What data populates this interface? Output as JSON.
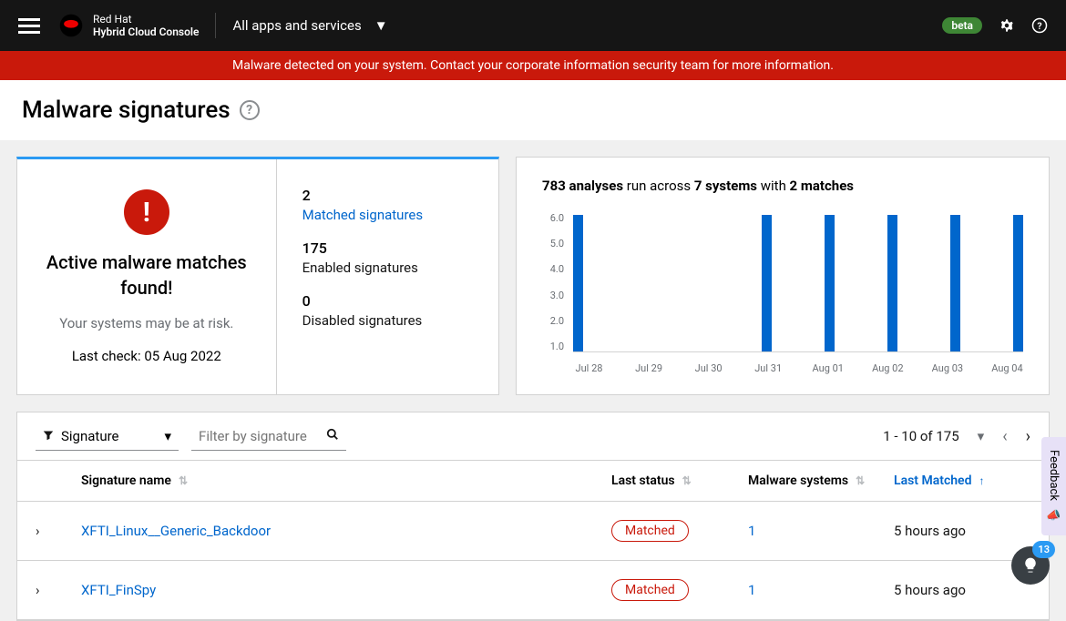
{
  "header": {
    "brand_top": "Red Hat",
    "brand_bottom": "Hybrid Cloud Console",
    "apps_label": "All apps and services",
    "beta": "beta"
  },
  "alert": "Malware detected on your system. Contact your corporate information security team for more information.",
  "page": {
    "title": "Malware signatures"
  },
  "summary": {
    "title_line1": "Active malware matches",
    "title_line2": "found!",
    "subtitle": "Your systems may be at risk.",
    "last_check_label": "Last check: ",
    "last_check_date": "05 Aug 2022"
  },
  "stats": {
    "matched_count": "2",
    "matched_label": "Matched signatures",
    "enabled_count": "175",
    "enabled_label": "Enabled signatures",
    "disabled_count": "0",
    "disabled_label": "Disabled signatures"
  },
  "analyses": {
    "count": "783",
    "text1": " analyses ",
    "text2": "run across ",
    "systems": "7 systems",
    "text3": " with ",
    "matches": "2 matches"
  },
  "chart_data": {
    "type": "bar",
    "categories": [
      "Jul 28",
      "Jul 29",
      "Jul 30",
      "Jul 31",
      "Aug 01",
      "Aug 02",
      "Aug 03",
      "Aug 04"
    ],
    "values": [
      6.0,
      0,
      0,
      6.0,
      6.0,
      6.0,
      6.0,
      6.0
    ],
    "ylim": [
      0,
      6.0
    ],
    "yticks": [
      "6.0",
      "5.0",
      "4.0",
      "3.0",
      "2.0",
      "1.0"
    ]
  },
  "toolbar": {
    "filter_label": "Signature",
    "search_placeholder": "Filter by signature",
    "pagination": "1 - 10 of 175"
  },
  "columns": {
    "name": "Signature name",
    "status": "Last status",
    "systems": "Malware systems",
    "matched": "Last Matched"
  },
  "rows": [
    {
      "name": "XFTI_Linux__Generic_Backdoor",
      "status": "Matched",
      "systems": "1",
      "last": "5 hours ago"
    },
    {
      "name": "XFTI_FinSpy",
      "status": "Matched",
      "systems": "1",
      "last": "5 hours ago"
    }
  ],
  "feedback": "Feedback",
  "float_count": "13"
}
